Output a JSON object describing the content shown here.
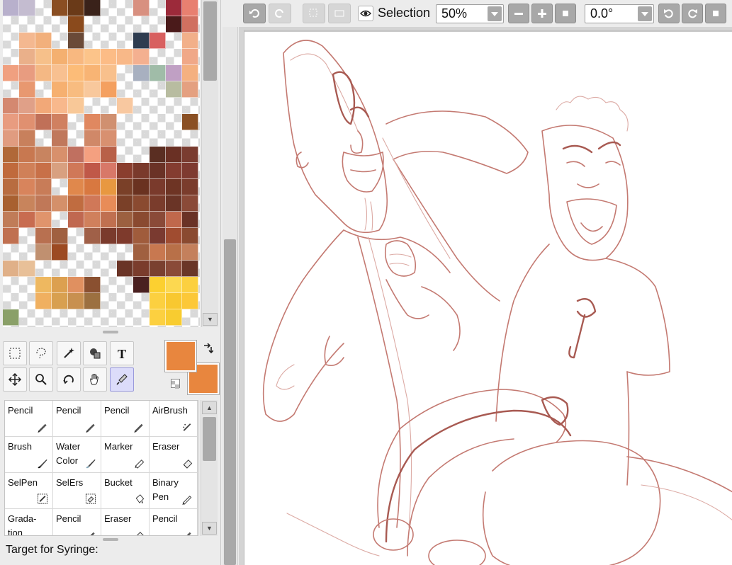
{
  "swatches": [
    "#b8b0cc",
    "#c4bcd0",
    "",
    "#8a4e22",
    "#6a3a18",
    "#3a221a",
    "",
    "",
    "#d89080",
    "",
    "#9c2a3a",
    "#e88070",
    "",
    "",
    "",
    "",
    "#8a4a1c",
    "",
    "",
    "",
    "",
    "",
    "#4a1a1a",
    "#d07060",
    "",
    "#f4b890",
    "#f2b07c",
    "",
    "#6a4a38",
    "",
    "",
    "",
    "#2e3c50",
    "#d86060",
    "",
    "#f2b08a",
    "",
    "#eab08a",
    "#f6c08a",
    "#f4b070",
    "#f8b880",
    "#fcc48a",
    "#fcbc86",
    "#f8b888",
    "#f4b090",
    "",
    "",
    "#f0a888",
    "#f0a080",
    "#e89c80",
    "#f4b884",
    "#f8c090",
    "#fcbc78",
    "#f8b474",
    "#f8c08c",
    "",
    "#a8b0c0",
    "#a0bca8",
    "#c0a0c4",
    "#f4b080",
    "",
    "#e89870",
    "",
    "#f6b070",
    "#f8bc80",
    "#f8c89c",
    "#f4a060",
    "",
    "",
    "",
    "#b8bca0",
    "#e4a080",
    "#d48870",
    "#e0a088",
    "#f2a878",
    "#f8b88c",
    "#f8c898",
    "",
    "",
    "#f8c8a0",
    "",
    "",
    "",
    "",
    "#e89c80",
    "#e09070",
    "#c07058",
    "#d08060",
    "",
    "#e08860",
    "#d09070",
    "",
    "",
    "",
    "",
    "#8a5024",
    "#e09c80",
    "#c8805c",
    "",
    "#c0785c",
    "",
    "#d08868",
    "#d89070",
    "",
    "",
    "",
    "",
    "",
    "#b06838",
    "#c87850",
    "#c88460",
    "#d8906c",
    "#c07060",
    "#f4a080",
    "#b86048",
    "",
    "",
    "#5a2e22",
    "#6a3024",
    "#7a3c30",
    "#c06a3c",
    "#d08058",
    "#c87048",
    "#d8a080",
    "#d07858",
    "#c05848",
    "#d87868",
    "#8a3e2e",
    "#7a3a2c",
    "#6a3226",
    "#843c30",
    "#7e3a30",
    "#b86c40",
    "#d8845c",
    "#c87c58",
    "",
    "#e0884c",
    "#d87840",
    "#e89840",
    "#7a4028",
    "#6a3220",
    "#7a3a2c",
    "#6e3424",
    "#7a3c2c",
    "#a86030",
    "#c8845c",
    "#c07858",
    "#d4906a",
    "#c06c40",
    "#d07858",
    "#e88c58",
    "#7a4028",
    "#8a4a30",
    "#7a3c2c",
    "#6a3426",
    "#8a4a38",
    "#c07c58",
    "#c86c50",
    "#e0946c",
    "",
    "#c06850",
    "#d0805c",
    "#c07050",
    "#9c6040",
    "#8a4a30",
    "#8a4a38",
    "#c0684c",
    "#6a3226",
    "#c07050",
    "",
    "#b87050",
    "#a06040",
    "",
    "#a06048",
    "#7a3a2c",
    "#7e3a2c",
    "#a05c3c",
    "#7a3a30",
    "#a04c30",
    "#8a4a30",
    "",
    "",
    "#c09070",
    "#9c4a22",
    "",
    "",
    "",
    "",
    "#a06040",
    "#c87850",
    "#b87048",
    "#c4805c",
    "#e0b088",
    "#e8c098",
    "",
    "",
    "",
    "",
    "",
    "#6a3426",
    "#7a3c2c",
    "#7a4030",
    "#8a4a38",
    "#6a3628",
    "",
    "",
    "#eeb860",
    "#dca050",
    "#e09060",
    "#8a5030",
    "",
    "",
    "#4a2020",
    "#fcd030",
    "#fcd850",
    "#fcd040",
    "",
    "",
    "#f0b060",
    "#d8a050",
    "#c89050",
    "#9c7040",
    "",
    "",
    "",
    "#fcd040",
    "#f8c830",
    "#fcc838",
    "#8aa068",
    "",
    "",
    "",
    "",
    "",
    "",
    "",
    "",
    "#fcd040",
    "#f8cc30",
    ""
  ],
  "toolbar": {
    "selection_label": "Selection",
    "zoom_value": "50%",
    "rotation_value": "0.0°"
  },
  "colors": {
    "foreground": "#e8863e",
    "background": "#e8863e",
    "sketch_line": "#c47a72"
  },
  "tools": [
    {
      "id": "rect-select",
      "icon": "rect-select-icon"
    },
    {
      "id": "lasso",
      "icon": "lasso-icon"
    },
    {
      "id": "magic-wand",
      "icon": "magic-wand-icon"
    },
    {
      "id": "select-pen",
      "icon": "shapes-icon"
    },
    {
      "id": "text",
      "icon": "text-icon",
      "glyph": "T"
    },
    {
      "id": "move",
      "icon": "move-icon"
    },
    {
      "id": "zoom",
      "icon": "zoom-icon"
    },
    {
      "id": "rotate",
      "icon": "rotate-icon"
    },
    {
      "id": "hand",
      "icon": "hand-icon"
    },
    {
      "id": "syringe",
      "icon": "syringe-icon",
      "active": true
    }
  ],
  "brushes": [
    {
      "label": "Pencil",
      "icon": "pencil-icon"
    },
    {
      "label": "Pencil",
      "icon": "pencil-icon"
    },
    {
      "label": "Pencil",
      "icon": "pencil-icon"
    },
    {
      "label": "AirBrush",
      "icon": "airbrush-icon"
    },
    {
      "label": "Brush",
      "icon": "brush-icon"
    },
    {
      "label": "Water\nColor",
      "icon": "watercolor-icon"
    },
    {
      "label": "Marker",
      "icon": "marker-icon"
    },
    {
      "label": "Eraser",
      "icon": "eraser-icon"
    },
    {
      "label": "SelPen",
      "icon": "selpen-icon"
    },
    {
      "label": "SelErs",
      "icon": "selers-icon"
    },
    {
      "label": "Bucket",
      "icon": "bucket-icon"
    },
    {
      "label": "Binary\nPen",
      "icon": "binary-pen-icon"
    },
    {
      "label": "Grada-\ntion",
      "icon": "gradation-icon"
    },
    {
      "label": "Pencil",
      "icon": "pencil-icon"
    },
    {
      "label": "Eraser",
      "icon": "eraser-icon"
    },
    {
      "label": "Pencil",
      "icon": "pencil-icon"
    }
  ],
  "syringe_target_label": "Target for Syringe:"
}
